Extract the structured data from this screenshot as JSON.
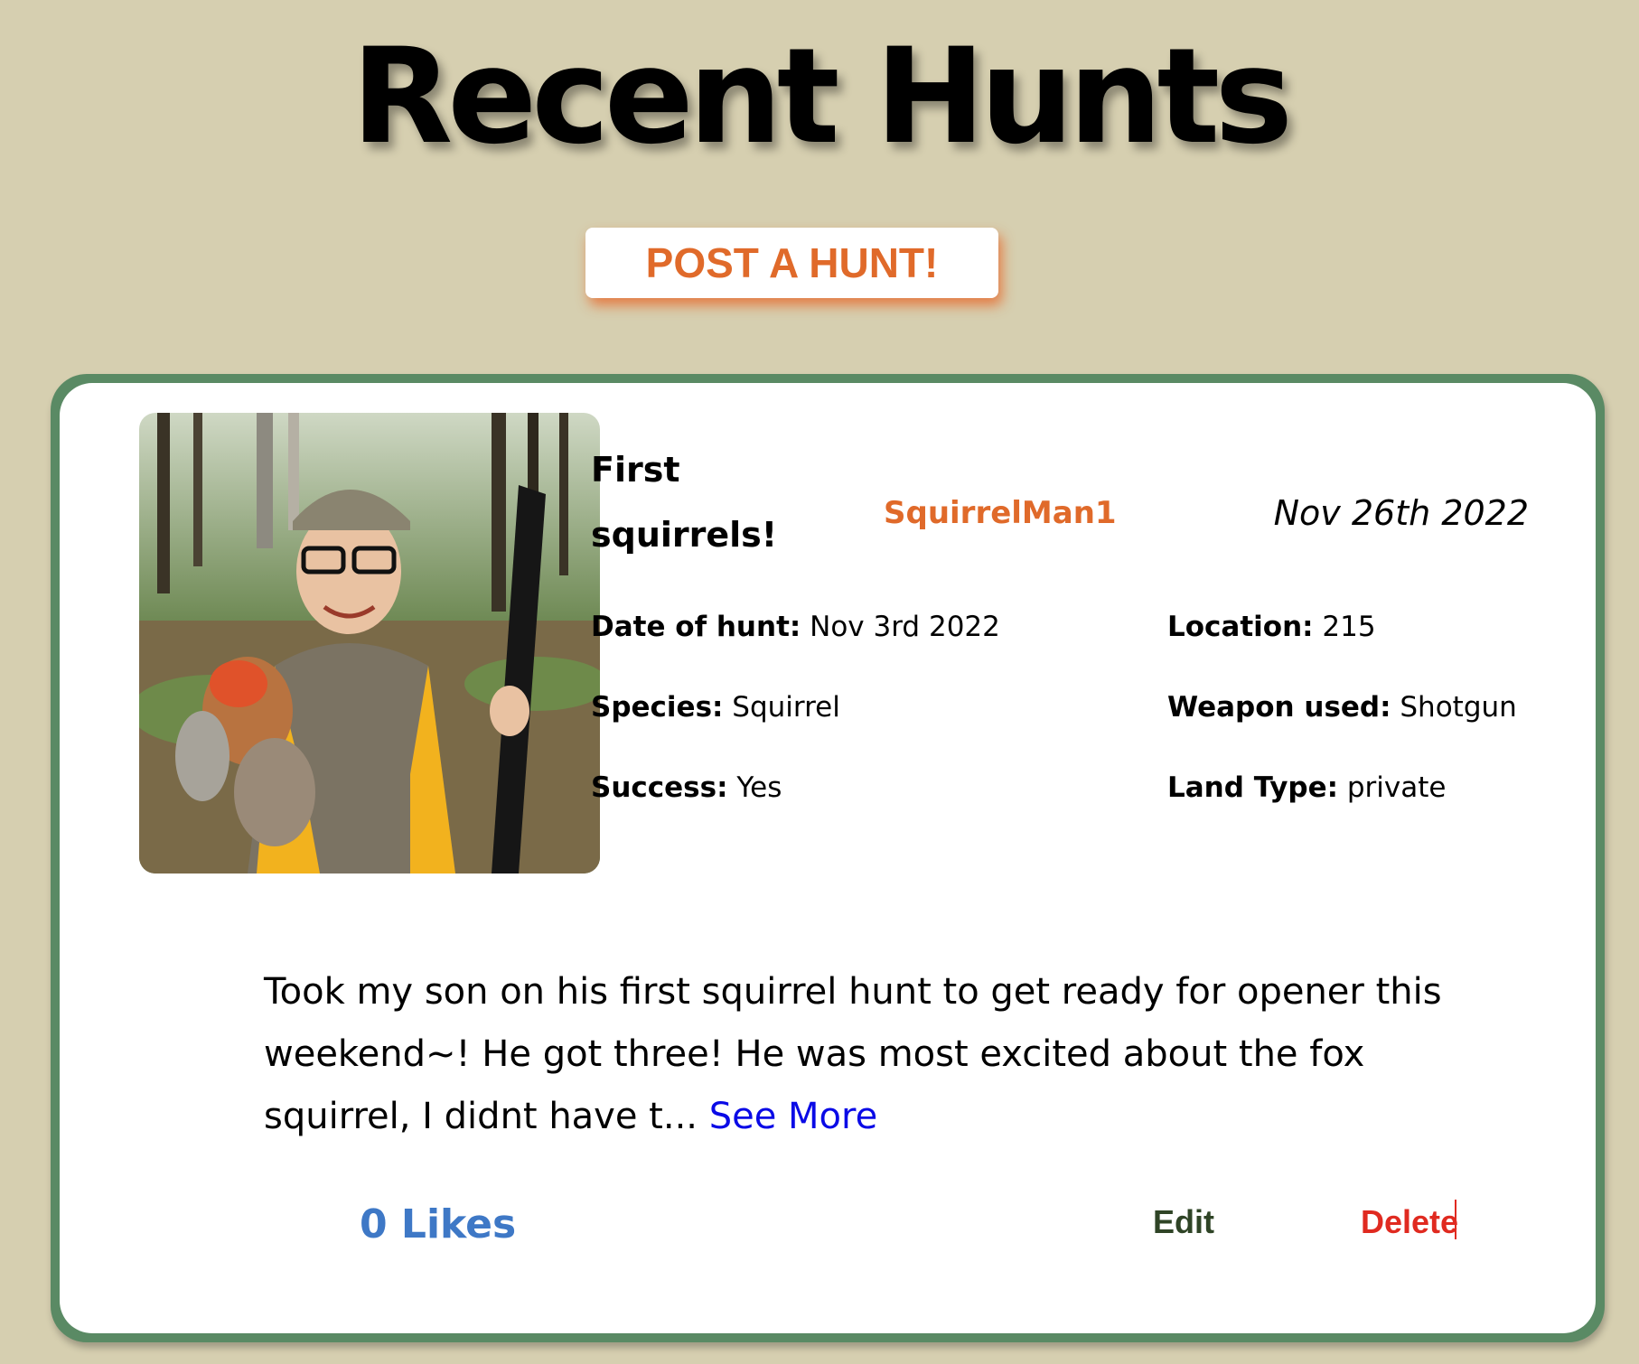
{
  "page": {
    "title": "Recent Hunts",
    "post_button_label": "POST A HUNT!"
  },
  "colors": {
    "background": "#d6cfb0",
    "card_border": "#5a8a64",
    "accent_orange": "#e06a2a",
    "link_blue": "#0a0ae6",
    "likes_blue": "#3e78c6",
    "edit_green": "#2f4426",
    "delete_red": "#e02a20"
  },
  "hunt": {
    "title": "First squirrels!",
    "author": "SquirrelMan1",
    "posted_date": "Nov 26th 2022",
    "photo_alt": "hunt-photo",
    "details": {
      "date_of_hunt_label": "Date of hunt:",
      "date_of_hunt": "Nov 3rd 2022",
      "location_label": "Location:",
      "location": "215",
      "species_label": "Species:",
      "species": "Squirrel",
      "weapon_label": "Weapon used:",
      "weapon": "Shotgun",
      "success_label": "Success:",
      "success": "Yes",
      "land_type_label": "Land Type:",
      "land_type": "private"
    },
    "description": "Took my son on his first squirrel hunt to get ready for opener this weekend~! He got three! He was most excited about the fox squirrel, I didnt have t...",
    "see_more_label": "See More",
    "likes_label": "0 Likes",
    "edit_label": "Edit",
    "delete_label": "Delete"
  }
}
